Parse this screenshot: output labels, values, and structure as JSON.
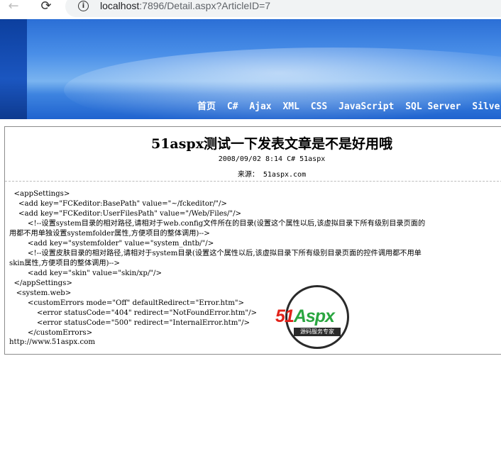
{
  "browser": {
    "url_host": "localhost",
    "url_rest": ":7896/Detail.aspx?ArticleID=7",
    "back_icon": "←",
    "reload_icon": "⟳",
    "info_icon": "i"
  },
  "menu": {
    "items": [
      "首页",
      "C#",
      "Ajax",
      "XML",
      "CSS",
      "JavaScript",
      "SQL Server",
      "SilverLi"
    ]
  },
  "article": {
    "title": "51aspx测试一下发表文章是不是好用哦",
    "meta": "2008/09/02 8:14 C# 51aspx",
    "source": "来源： 51aspx.com",
    "code_lines": [
      "  <appSettings>",
      "    <add key=\"FCKeditor:BasePath\" value=\"~/fckeditor/\"/>",
      "    <add key=\"FCKeditor:UserFilesPath\" value=\"/Web/Files/\"/>",
      "        <!--设置system目录的相对路径,请相对于web.config文件所在的目录(设置这个属性以后,该虚拟目录下所有级别目录页面的",
      "用都不用单独设置systemfolder属性,方便项目的整体调用)-->",
      "        <add key=\"systemfolder\" value=\"system_dntb/\"/>",
      "        <!--设置皮肤目录的相对路径,请相对于system目录(设置这个属性以后,该虚拟目录下所有级别目录页面的控件调用都不用单",
      "skin属性,方便项目的整体调用)-->",
      "        <add key=\"skin\" value=\"skin/xp/\"/>",
      "  </appSettings>",
      "   <system.web>",
      "        <customErrors mode=\"Off\" defaultRedirect=\"Error.htm\">",
      "            <error statusCode=\"404\" redirect=\"NotFoundError.htm\"/>",
      "            <error statusCode=\"500\" redirect=\"InternalError.htm\"/>",
      "        </customErrors>"
    ],
    "footer_url": "http://www.51aspx.com"
  },
  "watermark": {
    "brand_num": "51",
    "brand_text": "Aspx",
    "tagline": "源码服务专家"
  }
}
